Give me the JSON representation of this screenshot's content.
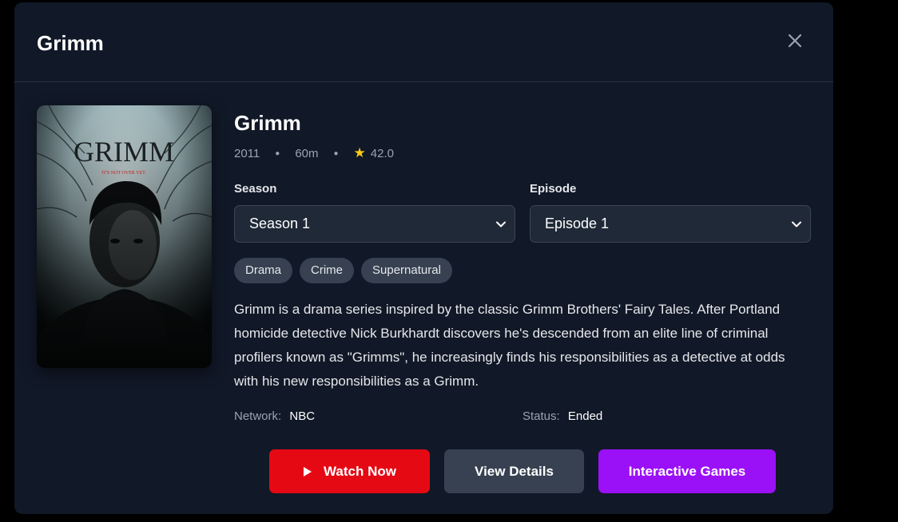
{
  "modal": {
    "title": "Grimm",
    "close_icon": "close-icon"
  },
  "poster": {
    "title_text": "GRIMM",
    "tagline": "IT'S NOT OVER YET."
  },
  "show": {
    "title": "Grimm",
    "year": "2011",
    "runtime": "60m",
    "rating": "42.0",
    "rating_icon": "star-icon"
  },
  "season": {
    "label": "Season",
    "value": "Season 1"
  },
  "episode": {
    "label": "Episode",
    "value": "Episode 1"
  },
  "genres": [
    "Drama",
    "Crime",
    "Supernatural"
  ],
  "description": "Grimm is a drama series inspired by the classic Grimm Brothers' Fairy Tales. After Portland homicide detective Nick Burkhardt discovers he's descended from an elite line of criminal profilers known as \"Grimms\", he increasingly finds his responsibilities as a detective at odds with his new responsibilities as a Grimm.",
  "details": {
    "network_label": "Network:",
    "network_value": "NBC",
    "status_label": "Status:",
    "status_value": "Ended"
  },
  "actions": {
    "watch_label": "Watch Now",
    "details_label": "View Details",
    "games_label": "Interactive Games"
  },
  "colors": {
    "background": "#000000",
    "modal": "#111827",
    "watch": "#e50914",
    "details": "#374151",
    "games": "#9b11f7",
    "star": "#facc15"
  }
}
